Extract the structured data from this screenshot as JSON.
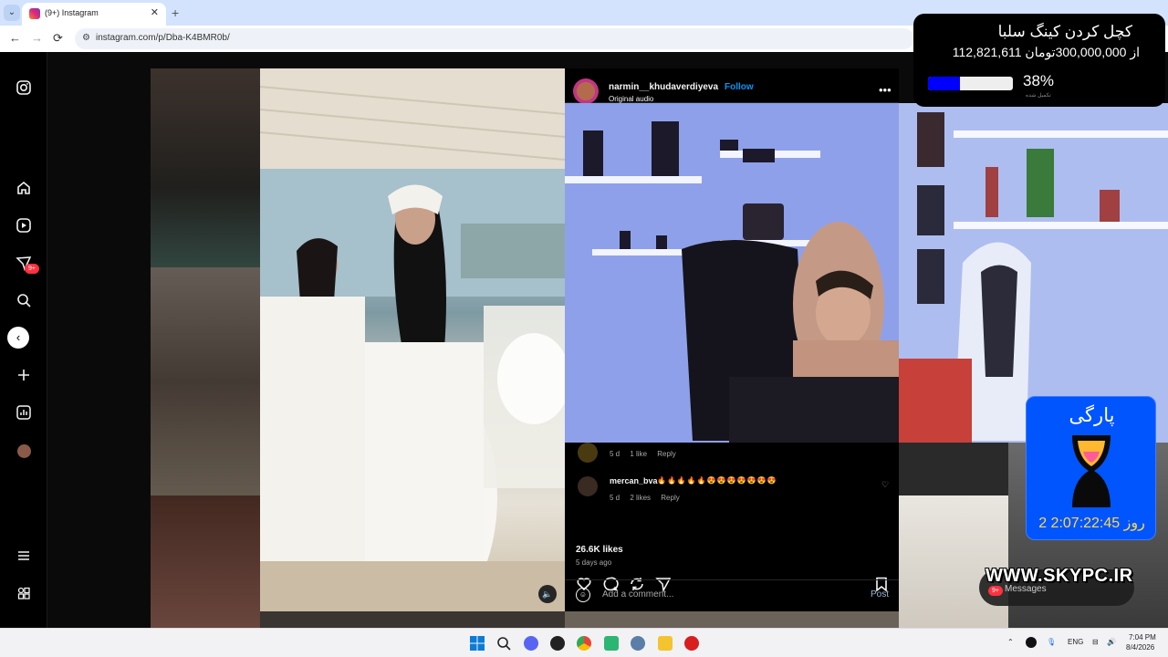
{
  "browser": {
    "tab_title": "(9+) Instagram",
    "tab_close": "✕",
    "new_tab": "+",
    "url": "instagram.com/p/Dba-K4BMR0b/",
    "back": "←",
    "forward": "→",
    "reload": "⟳"
  },
  "sidebar": {
    "notification_badge": "9+"
  },
  "post": {
    "username": "narmin__khudaverdiyeva",
    "follow": "Follow",
    "audio": "Original audio",
    "more": "•••",
    "comments": [
      {
        "username": "",
        "text": "",
        "time": "5 d",
        "likes": "1 like",
        "reply": "Reply"
      },
      {
        "username": "mercan_bva",
        "text": "🔥🔥🔥🔥🔥😍😍😍😍😍😍😍",
        "time": "5 d",
        "likes": "2 likes",
        "reply": "Reply"
      }
    ],
    "likes": "26.6K likes",
    "date": "5 days ago",
    "comment_placeholder": "Add a comment...",
    "post_button": "Post"
  },
  "stream_overlay": {
    "donation_title": "کچل کردن کینگ سلبا",
    "donation_amount": "112,821,611 از 300,000,000تومان",
    "donation_progress": 0.38,
    "donation_percent": "38%",
    "donation_sub": "تکمیل شده",
    "timer_title": "پارگی",
    "timer_value": "2 روز 2:07:22:45",
    "watermark": "WWW.SKYPC.IR",
    "messages_label": "Messages",
    "messages_badge": "9+"
  },
  "taskbar": {
    "lang": "ENG",
    "time": "7:04 PM",
    "date": "8/4/2026"
  },
  "colors": {
    "instagram_blue": "#0095f6",
    "progress_fill": "#0000ff",
    "timer_bg": "#0055ff",
    "timer_text": "#ffd84a"
  }
}
